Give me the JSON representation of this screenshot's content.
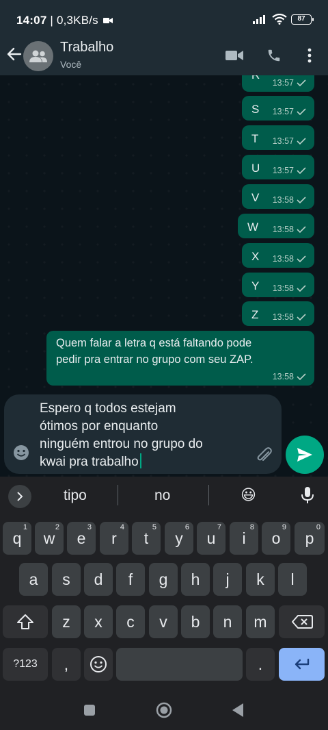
{
  "status": {
    "time": "14:07",
    "net_speed": " | 0,3KB/s",
    "battery": "87"
  },
  "header": {
    "title": "Trabalho",
    "subtitle": "Você"
  },
  "messages": [
    {
      "text": "R",
      "time": "13:57"
    },
    {
      "text": "S",
      "time": "13:57"
    },
    {
      "text": "T",
      "time": "13:57"
    },
    {
      "text": "U",
      "time": "13:57"
    },
    {
      "text": "V",
      "time": "13:58"
    },
    {
      "text": "W",
      "time": "13:58"
    },
    {
      "text": "X",
      "time": "13:58"
    },
    {
      "text": "Y",
      "time": "13:58"
    },
    {
      "text": "Z",
      "time": "13:58"
    },
    {
      "text_line1": "Quem falar a letra q está faltando pode",
      "text_line2": "pedir pra entrar no grupo com seu ZAP.",
      "time": "13:58"
    }
  ],
  "composer": {
    "lines": [
      "Espero q todos estejam",
      "ótimos por enquanto",
      "ninguém entrou no grupo do",
      "kwai pra trabalho"
    ]
  },
  "keyboard": {
    "suggestions": [
      "tipo",
      "no",
      "😃"
    ],
    "row1": [
      "q",
      "w",
      "e",
      "r",
      "t",
      "y",
      "u",
      "i",
      "o",
      "p"
    ],
    "row1_nums": [
      "1",
      "2",
      "3",
      "4",
      "5",
      "6",
      "7",
      "8",
      "9",
      "0"
    ],
    "row2": [
      "a",
      "s",
      "d",
      "f",
      "g",
      "h",
      "j",
      "k",
      "l"
    ],
    "row3": [
      "z",
      "x",
      "c",
      "v",
      "b",
      "n",
      "m"
    ],
    "symbols_label": "?123",
    "comma": ",",
    "period": "."
  },
  "colors": {
    "bubble_out": "#005c4b",
    "accent": "#00a884",
    "header": "#1f2c34"
  },
  "icons": [
    "back-arrow-icon",
    "group-avatar-icon",
    "video-call-icon",
    "phone-icon",
    "more-vert-icon",
    "emoji-icon",
    "attach-icon",
    "send-icon",
    "mic-icon",
    "shift-icon",
    "backspace-icon",
    "enter-icon"
  ]
}
